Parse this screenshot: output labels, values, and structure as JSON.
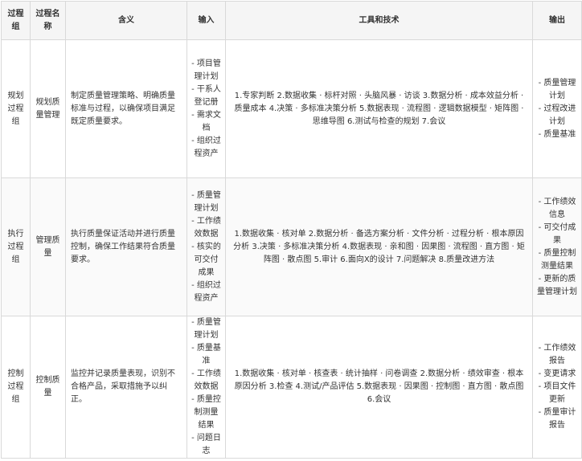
{
  "headers": [
    "过程组",
    "过程名称",
    "含义",
    "输入",
    "工具和技术",
    "输出"
  ],
  "rows": [
    {
      "group": "规划过程组",
      "name": "规划质量管理",
      "meaning": "制定质量管理策略、明确质量标准与过程，以确保项目满足既定质量要求。",
      "inputs": [
        "- 项目管理计划",
        "- 干系人登记册",
        "- 需求文档",
        "- 组织过程资产"
      ],
      "tools": "1.专家判断 2.数据收集 · 标杆对照 · 头脑风暴 · 访谈 3.数据分析 · 成本效益分析 · 质量成本 4.决策 · 多标准决策分析 5.数据表现 · 流程图 · 逻辑数据模型 · 矩阵图 · 思维导图 6.测试与检查的规划 7.会议",
      "outputs": [
        "- 质量管理计划",
        "- 过程改进计划",
        "- 质量基准"
      ]
    },
    {
      "group": "执行过程组",
      "name": "管理质量",
      "meaning": "执行质量保证活动并进行质量控制，确保工作结果符合质量要求。",
      "inputs": [
        "- 质量管理计划",
        "- 工作绩效数据",
        "- 核实的可交付成果",
        "- 组织过程资产"
      ],
      "tools": "1.数据收集 · 核对单 2.数据分析 · 备选方案分析 · 文件分析 · 过程分析 · 根本原因分析 3.决策 · 多标准决策分析 4.数据表现 · 亲和图 · 因果图 · 流程图 · 直方图 · 矩阵图 · 散点图 5.审计 6.面向X的设计 7.问题解决 8.质量改进方法",
      "outputs": [
        "- 工作绩效信息",
        "- 可交付成果",
        "- 质量控制测量结果",
        "- 更新的质量管理计划"
      ]
    },
    {
      "group": "控制过程组",
      "name": "控制质量",
      "meaning": "监控并记录质量表现，识别不合格产品，采取措施予以纠正。",
      "inputs": [
        "- 质量管理计划",
        "- 质量基准",
        "- 工作绩效数据",
        "- 质量控制测量结果",
        "- 问题日志"
      ],
      "tools": "1.数据收集 · 核对单 · 核查表 · 统计抽样 · 问卷调查 2.数据分析 · 绩效审查 · 根本原因分析 3.检查 4.测试/产品评估 5.数据表现 · 因果图 · 控制图 · 直方图 · 散点图 6.会议",
      "outputs": [
        "- 工作绩效报告",
        "- 变更请求",
        "- 项目文件更新",
        "- 质量审计报告"
      ]
    }
  ]
}
